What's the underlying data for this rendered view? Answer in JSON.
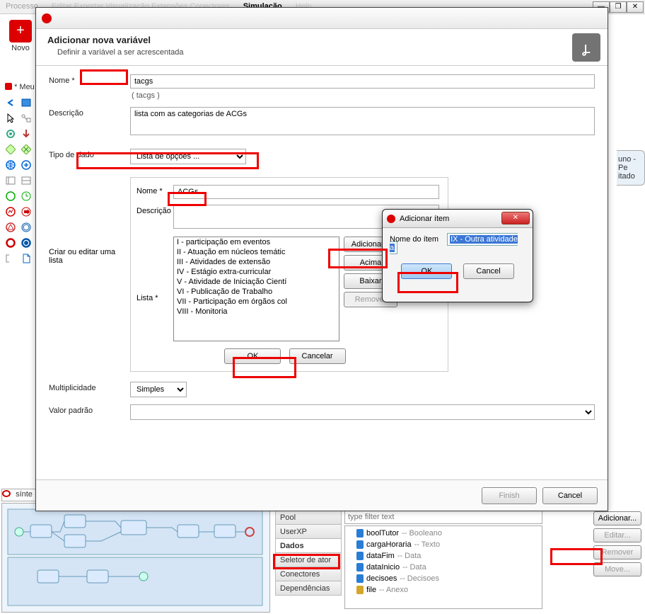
{
  "menubar": [
    "Processo",
    "Editar",
    "Exportar",
    "Visualização",
    "Extensões",
    "Conectores",
    "Simulação",
    "Help"
  ],
  "winctrls": [
    "—",
    "❐",
    "✕"
  ],
  "novo_label": "Novo",
  "meu_label": "* Meu",
  "right_snip": {
    "a": "uno - Pe",
    "b": "itado"
  },
  "bottom_tab": "sínte",
  "dialog": {
    "title": "Adicionar nova variável",
    "subtitle": "Definir a variável a ser acrescentada",
    "rows": {
      "nome_label": "Nome *",
      "nome_value": "tacgs",
      "paren": "(   tacgs   )",
      "desc_label": "Descrição",
      "desc_value": "lista com as categorias de ACGs",
      "tipo_label": "Tipo de dado",
      "tipo_value": "Lista de opções ...",
      "mult_label": "Multiplicidade",
      "mult_value": "Simples",
      "valor_label": "Valor padrão",
      "valor_value": ""
    },
    "section_label": "Criar ou editar uma lista",
    "inner": {
      "nome_label": "Nome *",
      "nome_value": "ACGs",
      "desc_label": "Descrição",
      "desc_value": "",
      "lista_label": "Lista *",
      "items": [
        "I - participação em eventos",
        "II - Atuação em núcleos temátic",
        "III - Atividades de extensão",
        "IV - Estágio extra-curricular",
        "V - Atividade de Iniciação Cientí",
        "VI - Publicação de Trabalho",
        "VII - Participação em órgãos col",
        "VIII - Monitoria"
      ],
      "btns": {
        "add": "Adicionar...",
        "up": "Acima",
        "down": "Baixar",
        "rem": "Remover"
      },
      "ok": "OK",
      "cancel": "Cancelar"
    },
    "footer": {
      "finish": "Finish",
      "cancel": "Cancel"
    }
  },
  "popup": {
    "title": "Adicionar ítem",
    "label": "Nome do ítem",
    "value": "IX - Outra atividade a",
    "ok": "OK",
    "cancel": "Cancel",
    "close": "✕"
  },
  "props": {
    "tabs": [
      "Pool",
      "UserXP",
      "Dados",
      "Seletor de ator",
      "Conectores",
      "Dependências"
    ],
    "filter_placeholder": "type filter text",
    "tree": [
      {
        "name": "boolTutor",
        "type": "Booleano"
      },
      {
        "name": "cargaHoraria",
        "type": "Texto"
      },
      {
        "name": "dataFim",
        "type": "Data"
      },
      {
        "name": "dataInicio",
        "type": "Data"
      },
      {
        "name": "decisoes",
        "type": "Decisoes"
      },
      {
        "name": "file",
        "type": "Anexo",
        "y": true
      }
    ],
    "btns": {
      "add": "Adicionar...",
      "edit": "Editar...",
      "rem": "Remover",
      "move": "Move..."
    }
  }
}
